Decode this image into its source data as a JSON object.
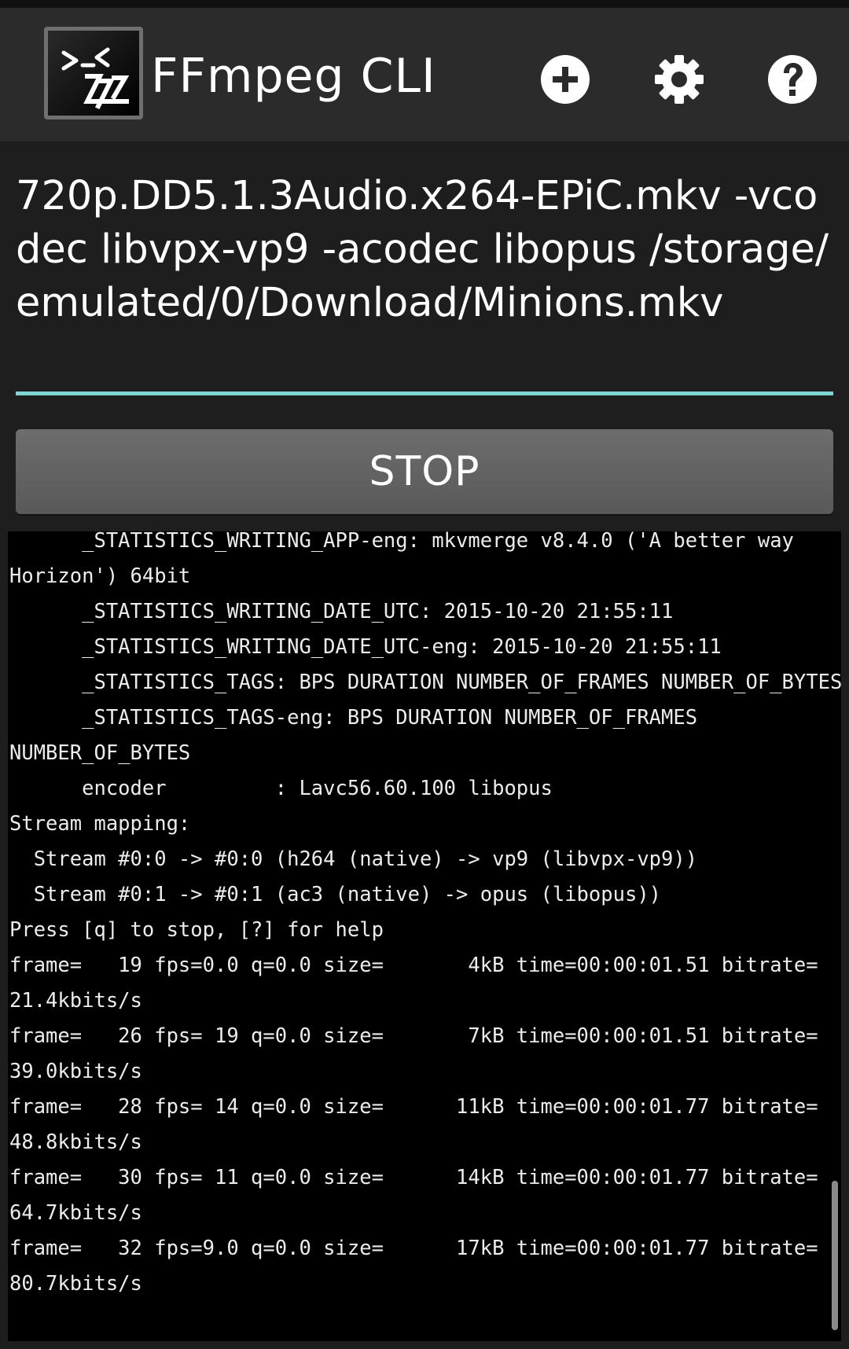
{
  "app": {
    "title": "FFmpeg CLI"
  },
  "toolbar": {
    "icons": [
      "add-icon",
      "settings-icon",
      "help-icon"
    ]
  },
  "command": {
    "value": "720p.DD5.1.3Audio.x264-EPiC.mkv -vcodec libvpx-vp9 -acodec libopus /storage/emulated/0/Download/Minions.mkv"
  },
  "stop_button": {
    "label": "STOP"
  },
  "console": {
    "lines": [
      "      _STATISTICS_WRITING_APP-eng: mkvmerge v8.4.0 ('A better way",
      "Horizon') 64bit",
      "      _STATISTICS_WRITING_DATE_UTC: 2015-10-20 21:55:11",
      "      _STATISTICS_WRITING_DATE_UTC-eng: 2015-10-20 21:55:11",
      "      _STATISTICS_TAGS: BPS DURATION NUMBER_OF_FRAMES NUMBER_OF_BYTES",
      "      _STATISTICS_TAGS-eng: BPS DURATION NUMBER_OF_FRAMES",
      "NUMBER_OF_BYTES",
      "      encoder         : Lavc56.60.100 libopus",
      "Stream mapping:",
      "  Stream #0:0 -> #0:0 (h264 (native) -> vp9 (libvpx-vp9))",
      "  Stream #0:1 -> #0:1 (ac3 (native) -> opus (libopus))",
      "Press [q] to stop, [?] for help",
      "frame=   19 fps=0.0 q=0.0 size=       4kB time=00:00:01.51 bitrate=",
      "21.4kbits/s",
      "frame=   26 fps= 19 q=0.0 size=       7kB time=00:00:01.51 bitrate=",
      "39.0kbits/s",
      "frame=   28 fps= 14 q=0.0 size=      11kB time=00:00:01.77 bitrate=",
      "48.8kbits/s",
      "frame=   30 fps= 11 q=0.0 size=      14kB time=00:00:01.77 bitrate=",
      "64.7kbits/s",
      "frame=   32 fps=9.0 q=0.0 size=      17kB time=00:00:01.77 bitrate=",
      "80.7kbits/s",
      ""
    ]
  }
}
